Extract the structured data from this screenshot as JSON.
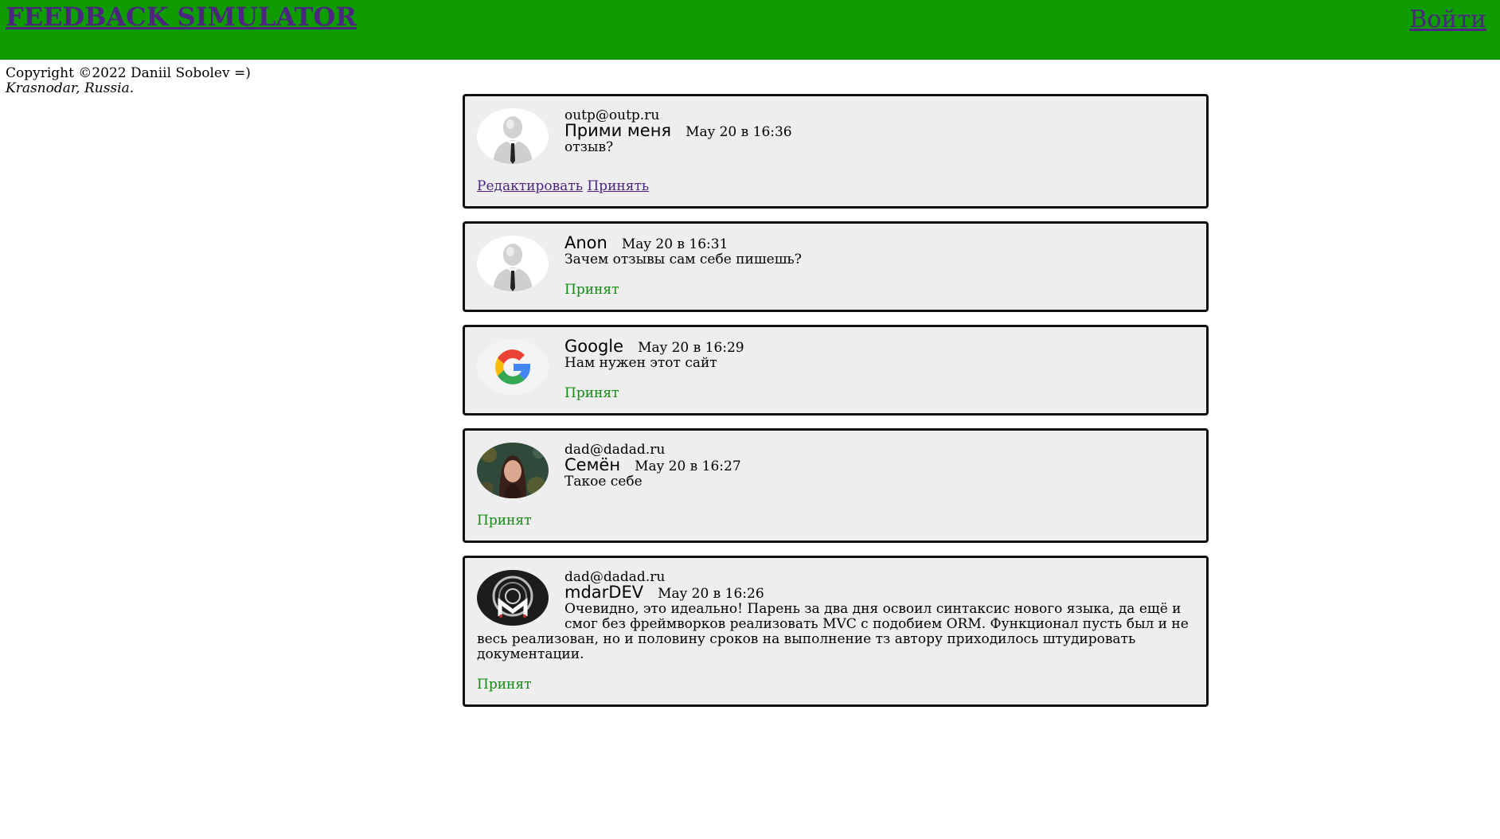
{
  "header": {
    "title": "FEEDBACK SIMULATOR",
    "login": "Войти",
    "bg_color": "#0e9c00",
    "link_color": "#4b2580"
  },
  "footer": {
    "copyright": "Copyright ©2022 Daniil Sobolev =)",
    "location": "Krasnodar, Russia."
  },
  "feedback": [
    {
      "avatar": "default-user-avatar",
      "email": "outp@outp.ru",
      "author": "Прими меня",
      "date": "May 20 в 16:36",
      "text": "отзыв?",
      "edit_label": "Редактировать",
      "accept_label": "Принять"
    },
    {
      "avatar": "default-user-avatar",
      "author": "Anon",
      "date": "May 20 в 16:31",
      "text": "Зачем отзывы сам себе пишешь?",
      "status": "Принят"
    },
    {
      "avatar": "google-logo-avatar",
      "author": "Google",
      "date": "May 20 в 16:29",
      "text": "Нам нужен этот сайт",
      "status": "Принят"
    },
    {
      "avatar": "portrait-avatar",
      "email": "dad@dadad.ru",
      "author": "Семён",
      "date": "May 20 в 16:27",
      "text": "Такое себе",
      "status": "Принят"
    },
    {
      "avatar": "m-logo-avatar",
      "email": "dad@dadad.ru",
      "author": "mdarDEV",
      "date": "May 20 в 16:26",
      "text": "Очевидно, это идеально! Парень за два дня освоил синтаксис нового языка, да ещё и смог без фреймворков реализовать MVC с подобием ORM. Функционал пусть был и не весь реализован, но и половину сроков на выполнение тз автору приходилось штудировать документации.",
      "status": "Принят"
    }
  ]
}
